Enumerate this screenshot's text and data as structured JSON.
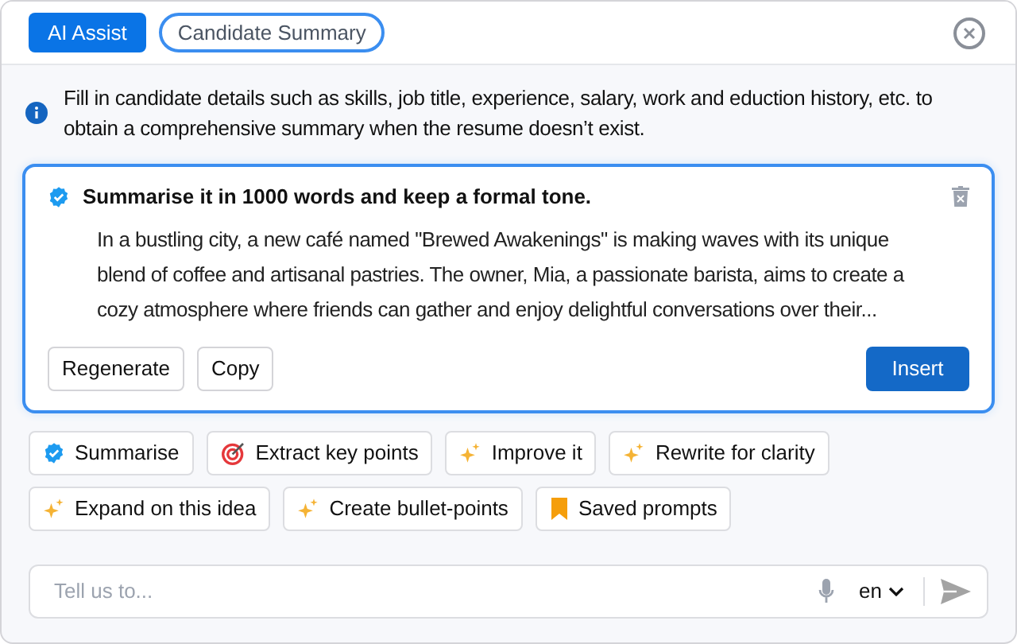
{
  "header": {
    "badge": "AI Assist",
    "chip": "Candidate Summary"
  },
  "info": "Fill in candidate details such as skills, job title, experience, salary, work and eduction history, etc. to obtain a comprehensive summary when the resume doesn’t exist.",
  "result": {
    "prompt": "Summarise it in 1000 words and keep a formal tone.",
    "lines": [
      "In a bustling city, a new café named \"Brewed Awakenings\" is making waves with its unique",
      "blend of coffee and artisanal pastries. The owner, Mia, a passionate barista, aims to create a",
      "cozy atmosphere where friends can gather and enjoy delightful conversations over their..."
    ],
    "actions": [
      "Regenerate",
      "Copy"
    ],
    "primary": "Insert"
  },
  "suggestions": [
    [
      {
        "label": "Summarise",
        "kind": "verified"
      },
      {
        "label": "Extract key points",
        "kind": "target"
      },
      {
        "label": "Improve it",
        "kind": "sparkle"
      },
      {
        "label": "Rewrite for clarity",
        "kind": "sparkle"
      }
    ],
    [
      {
        "label": "Expand on this idea",
        "kind": "sparkle"
      },
      {
        "label": "Create bullet-points",
        "kind": "sparkle"
      },
      {
        "label": "Saved prompts",
        "kind": "bookmark"
      }
    ]
  ],
  "composer": {
    "placeholder": "Tell us to...",
    "language": "en"
  }
}
